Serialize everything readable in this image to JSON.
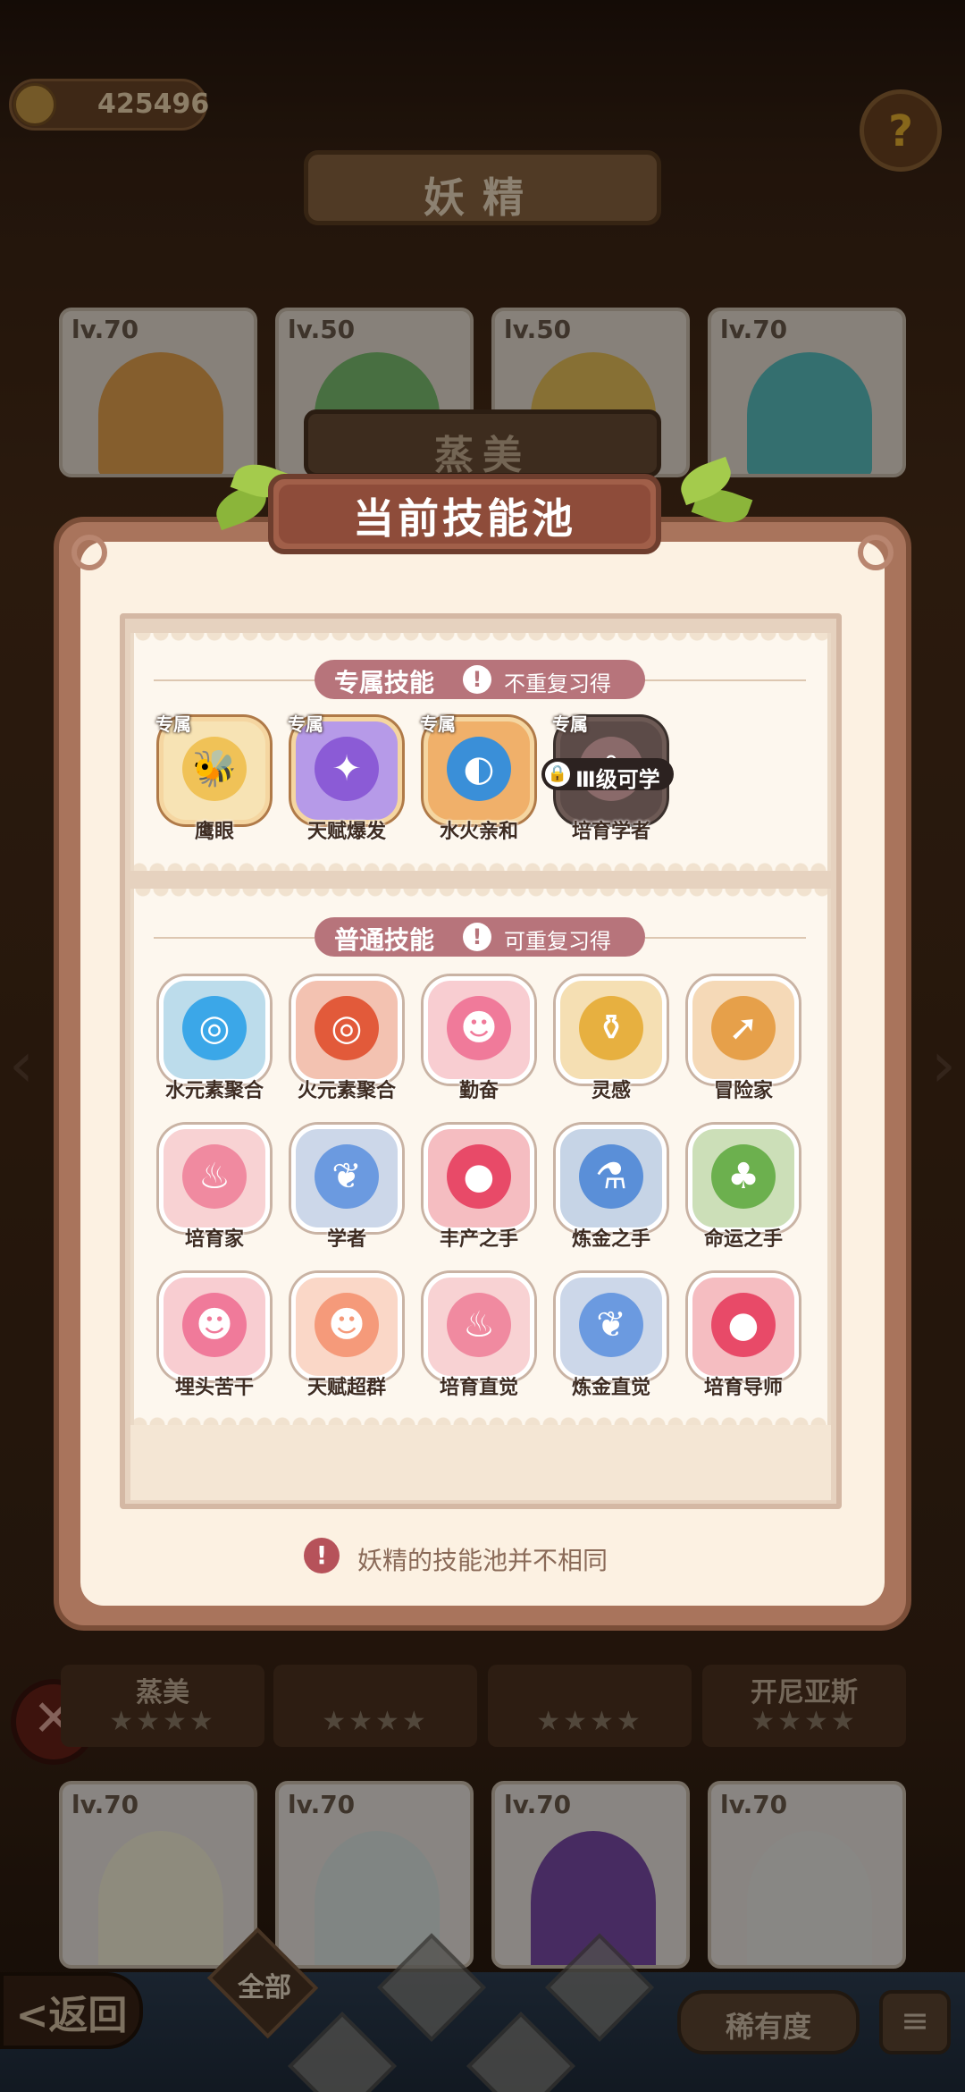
{
  "hud": {
    "coins": "425496",
    "help_icon": "?"
  },
  "header": {
    "title": "妖精"
  },
  "top_cards": [
    {
      "level": "lv.70",
      "color": "#e6a24e"
    },
    {
      "level": "lv.50",
      "color": "#7cc070"
    },
    {
      "level": "lv.50",
      "color": "#e8c15a"
    },
    {
      "level": "lv.70",
      "color": "#5ac0c0"
    }
  ],
  "selected_fairy_name": "蒸美",
  "dialog": {
    "title": "当前技能池",
    "exclusive": {
      "title": "专属技能",
      "note": "不重复习得",
      "tag": "专属",
      "lock_text": "Ⅲ级可学",
      "skills": [
        {
          "label": "鹰眼",
          "icon": "🐝",
          "color": "#f0c257"
        },
        {
          "label": "天赋爆发",
          "icon": "✦",
          "color": "#8b5bd6"
        },
        {
          "label": "水火亲和",
          "icon": "◐",
          "color": "#3a8fd8"
        },
        {
          "label": "培育学者",
          "icon": "❀",
          "color": "#8a6a6a"
        }
      ]
    },
    "normal": {
      "title": "普通技能",
      "note": "可重复习得",
      "rows": [
        [
          {
            "label": "水元素聚合",
            "icon": "◎",
            "color": "#3ba7e8"
          },
          {
            "label": "火元素聚合",
            "icon": "◎",
            "color": "#e25a3a"
          },
          {
            "label": "勤奋",
            "icon": "☻",
            "color": "#f07a9a"
          },
          {
            "label": "灵感",
            "icon": "⚱",
            "color": "#e7b040"
          },
          {
            "label": "冒险家",
            "icon": "➚",
            "color": "#e6a04a"
          }
        ],
        [
          {
            "label": "培育家",
            "icon": "♨",
            "color": "#f08aa0"
          },
          {
            "label": "学者",
            "icon": "❦",
            "color": "#6b9ae0"
          },
          {
            "label": "丰产之手",
            "icon": "●",
            "color": "#e84a68"
          },
          {
            "label": "炼金之手",
            "icon": "⚗",
            "color": "#5a8fd8"
          },
          {
            "label": "命运之手",
            "icon": "♣",
            "color": "#6cb04e"
          }
        ],
        [
          {
            "label": "埋头苦干",
            "icon": "☻",
            "color": "#f07a9a"
          },
          {
            "label": "天赋超群",
            "icon": "☻",
            "color": "#f59a7a"
          },
          {
            "label": "培育直觉",
            "icon": "♨",
            "color": "#f08aa0"
          },
          {
            "label": "炼金直觉",
            "icon": "❦",
            "color": "#6b9ae0"
          },
          {
            "label": "培育导师",
            "icon": "●",
            "color": "#e84a68"
          }
        ]
      ]
    },
    "footer_note": "妖精的技能池并不相同"
  },
  "name_strips": [
    {
      "name": "蒸美",
      "stars": "★★★★"
    },
    {
      "name": "",
      "stars": "★★★★"
    },
    {
      "name": "",
      "stars": "★★★★"
    },
    {
      "name": "开尼亚斯",
      "stars": "★★★★"
    }
  ],
  "bottom_cards": [
    {
      "level": "lv.70",
      "color": "#f4f0d8"
    },
    {
      "level": "lv.70",
      "color": "#dde6e2"
    },
    {
      "level": "lv.70",
      "color": "#7a4aa8"
    },
    {
      "level": "lv.70",
      "color": "#eae8e4"
    }
  ],
  "bottom_bar": {
    "back": "<返回",
    "all": "全部",
    "rarity": "稀有度",
    "sort_icon": "≡"
  }
}
